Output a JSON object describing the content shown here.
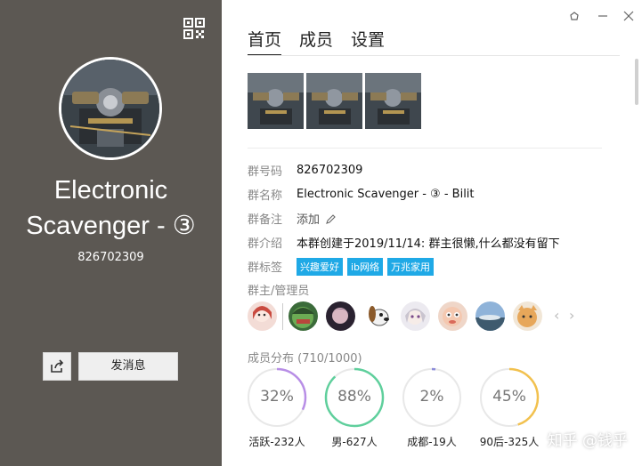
{
  "left": {
    "title_line1": "Electronic",
    "title_line2": "Scavenger - ③",
    "group_id": "826702309",
    "send_message": "发消息",
    "qr_icon": "qr-code-icon",
    "share_icon": "share-icon"
  },
  "tabs": [
    "首页",
    "成员",
    "设置"
  ],
  "window_controls": [
    "skin-icon",
    "minimize-icon",
    "close-icon"
  ],
  "info": {
    "id_label": "群号码",
    "id_value": "826702309",
    "name_label": "群名称",
    "name_value": "Electronic Scavenger - ③ - Bilit",
    "remark_label": "群备注",
    "remark_value": "添加",
    "intro_label": "群介绍",
    "intro_value": "本群创建于2019/11/14: 群主很懒,什么都没有留下",
    "tags_label": "群标签",
    "tags": [
      "兴趣爱好",
      "ib网络",
      "万兆家用"
    ]
  },
  "admins_label": "群主/管理员",
  "members_label": "成员分布 (710/1000)",
  "stats": [
    {
      "pct": "32%",
      "value": 32,
      "label": "活跃-232人",
      "color": "#b88ee6"
    },
    {
      "pct": "88%",
      "value": 88,
      "label": "男-627人",
      "color": "#5fcf9c"
    },
    {
      "pct": "2%",
      "value": 2,
      "label": "成都-19人",
      "color": "#8c8cd9"
    },
    {
      "pct": "45%",
      "value": 45,
      "label": "90后-325人",
      "color": "#f2c14e"
    }
  ],
  "watermark": "知乎 @钱乎",
  "colors": {
    "left_bg": "#5c5853",
    "tag_bg": "#1fa9e6"
  }
}
